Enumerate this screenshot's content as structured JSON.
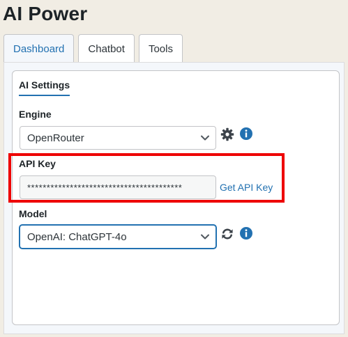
{
  "app": {
    "title": "AI Power"
  },
  "tabs": [
    {
      "label": "Dashboard",
      "active": true
    },
    {
      "label": "Chatbot",
      "active": false
    },
    {
      "label": "Tools",
      "active": false
    }
  ],
  "settings": {
    "section_label": "AI Settings",
    "engine": {
      "label": "Engine",
      "value": "OpenRouter"
    },
    "api_key": {
      "label": "API Key",
      "value": "****************************************",
      "link_label": "Get API Key"
    },
    "model": {
      "label": "Model",
      "value": "OpenAI: ChatGPT-4o"
    }
  },
  "colors": {
    "accent": "#2271b1",
    "highlight": "#ee0000",
    "background": "#f1ede4"
  },
  "icons": {
    "engine_settings": "gear-icon",
    "engine_info": "info-icon",
    "model_refresh": "refresh-icon",
    "model_info": "info-icon",
    "dropdown": "chevron-down-icon"
  }
}
